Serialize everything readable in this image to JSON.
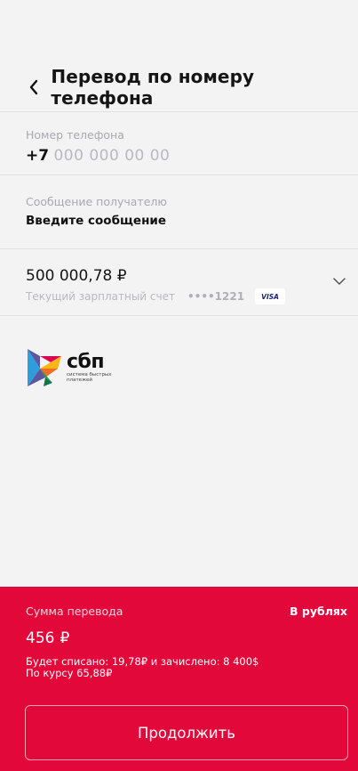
{
  "header": {
    "title": "Перевод по номеру телефона"
  },
  "phone_field": {
    "label": "Номер телефона",
    "prefix": "+7",
    "placeholder": "000 000 00 00"
  },
  "message_field": {
    "label": "Сообщение получателю",
    "placeholder": "Введите сообщение"
  },
  "account": {
    "balance": "500 000,78 ₽",
    "name": "Текущий зарплатный счет",
    "card_mask": "••••1221",
    "card_brand": "VISA"
  },
  "sbp_logo": {
    "word": "сбп",
    "subtitle": "система быстрых платежей"
  },
  "transfer": {
    "label": "Сумма перевода",
    "currency_toggle": "В рублях",
    "amount": "456",
    "currency_symbol": "₽",
    "info_line1": "Будет списано: 19,78₽  и зачислено: 8 400$",
    "info_line2": "По курсу 65,88₽",
    "continue_label": "Продолжить"
  },
  "colors": {
    "accent": "#e2083a",
    "background": "#f4f3f4"
  }
}
